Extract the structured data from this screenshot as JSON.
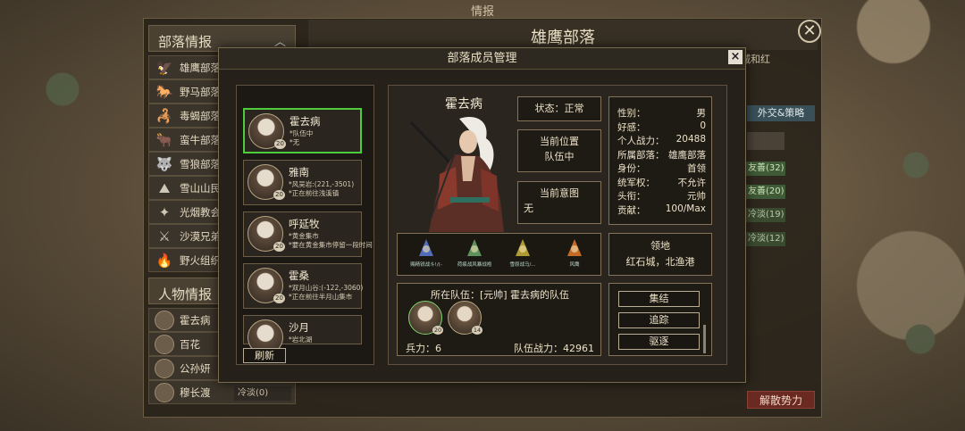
{
  "top_title": "情报",
  "background": {
    "tribe_section_label": "部落情报",
    "tribes": [
      "雄鹰部落",
      "野马部落",
      "毒蝎部落",
      "蛮牛部落",
      "雪狼部落",
      "雪山山民",
      "光烟教会",
      "沙漠兄弟",
      "野火组织"
    ],
    "character_section_label": "人物情报",
    "characters": [
      "霍去病",
      "百花",
      "公孙妍",
      "穆长渡"
    ],
    "center_title": "雄鹰部落",
    "right_text": "区城和红",
    "tab_label": "外交&策略",
    "relations": [
      "友善(32)",
      "友善(20)",
      "冷淡(19)",
      "冷淡(12)"
    ],
    "cold_label": "冷淡(0)",
    "dismiss_label": "解散势力"
  },
  "modal": {
    "title": "部落成员管理",
    "close_label": "×",
    "refresh_label": "刷新",
    "members": [
      {
        "name": "霍去病",
        "level": "20",
        "line1": "*队伍中",
        "line2": "*无"
      },
      {
        "name": "雅南",
        "level": "20",
        "line1": "*风吴岩:(221,-3501)",
        "line2": "*正在前往浅溪镇"
      },
      {
        "name": "呼延牧",
        "level": "20",
        "line1": "*黄金集市",
        "line2": "*要在黄金集市停留一段时间"
      },
      {
        "name": "霍桑",
        "level": "20",
        "line1": "*双月山谷:(-122,-3060)",
        "line2": "*正在前往半月山集市"
      },
      {
        "name": "沙月",
        "level": "",
        "line1": "*岩北湖",
        "line2": ""
      }
    ],
    "hero": {
      "name": "霍去病",
      "status": "状态：正常",
      "position_label": "当前位置",
      "position_value": "队伍中",
      "intent_label": "当前意图",
      "intent_value": "无",
      "stats": [
        {
          "k": "性别：",
          "v": "男"
        },
        {
          "k": "好感：",
          "v": "0"
        },
        {
          "k": "个人战力：",
          "v": "20488"
        },
        {
          "k": "所属部落：",
          "v": "雄鹰部落"
        },
        {
          "k": "身份：",
          "v": "首领"
        },
        {
          "k": "统军权：",
          "v": "不允许"
        },
        {
          "k": "头衔：",
          "v": "元帅"
        },
        {
          "k": "贡献：",
          "v": "100/Max"
        }
      ],
      "items": [
        {
          "label": "赐精锐战斗!/(-",
          "icon": "spear-icon",
          "color": "#5a7bd6"
        },
        {
          "label": "荷痕战风暴战袍",
          "icon": "robe-icon",
          "color": "#6aa86a"
        },
        {
          "label": "雪原战马/...",
          "icon": "horse-icon",
          "color": "#c9b23a"
        },
        {
          "label": "风鹰",
          "icon": "phoenix-icon",
          "color": "#e07a2a"
        }
      ],
      "territory_label": "领地",
      "territory_value": "红石城，北渔港",
      "team": {
        "title": "所在队伍：[元帅] 霍去病的队伍",
        "member_levels": [
          "20",
          "14"
        ],
        "strength": "兵力：6",
        "power": "队伍战力：42961"
      },
      "actions": [
        "集结",
        "追踪",
        "驱逐"
      ]
    }
  }
}
